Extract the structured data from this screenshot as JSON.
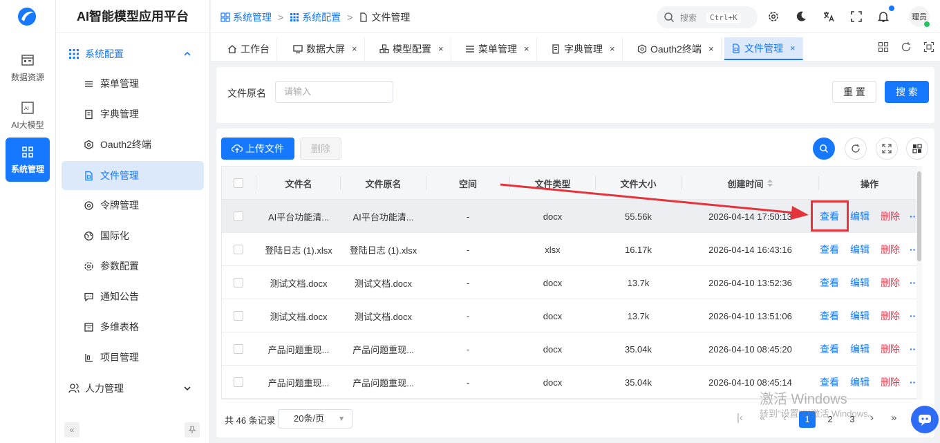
{
  "app": {
    "title": "AI智能模型应用平台"
  },
  "rail": {
    "items": [
      {
        "label": "数据资源"
      },
      {
        "label": "AI大模型"
      },
      {
        "label": "系统管理"
      }
    ]
  },
  "sidebar": {
    "group_open": "系统配置",
    "items": [
      {
        "label": "菜单管理"
      },
      {
        "label": "字典管理"
      },
      {
        "label": "Oauth2终端"
      },
      {
        "label": "文件管理"
      },
      {
        "label": "令牌管理"
      },
      {
        "label": "国际化"
      },
      {
        "label": "参数配置"
      },
      {
        "label": "通知公告"
      },
      {
        "label": "多维表格"
      },
      {
        "label": "项目管理"
      }
    ],
    "group_closed": "人力管理",
    "collapse_glyph": "«"
  },
  "breadcrumb": {
    "items": [
      "系统管理",
      "系统配置",
      "文件管理"
    ],
    "sep": ">"
  },
  "header": {
    "search_placeholder": "搜索",
    "shortcut": "Ctrl+K",
    "user": "理员"
  },
  "tabs": [
    {
      "label": "工作台"
    },
    {
      "label": "数据大屏",
      "close": "×"
    },
    {
      "label": "模型配置",
      "close": "×"
    },
    {
      "label": "菜单管理",
      "close": "×"
    },
    {
      "label": "字典管理",
      "close": "×"
    },
    {
      "label": "Oauth2终端",
      "close": "×"
    },
    {
      "label": "文件管理",
      "close": "×"
    }
  ],
  "filter": {
    "label": "文件原名",
    "placeholder": "请输入",
    "reset": "重 置",
    "search": "搜 索"
  },
  "toolbar": {
    "upload": "上传文件",
    "delete": "删除"
  },
  "table": {
    "columns": [
      "文件名",
      "文件原名",
      "空间",
      "文件类型",
      "文件大小",
      "创建时间",
      "操作"
    ],
    "rows": [
      {
        "name": "AI平台功能清...",
        "orig": "AI平台功能清...",
        "space": "-",
        "type": "docx",
        "size": "55.56k",
        "time": "2026-04-14 17:50:13"
      },
      {
        "name": "登陆日志 (1).xlsx",
        "orig": "登陆日志 (1).xlsx",
        "space": "-",
        "type": "xlsx",
        "size": "16.17k",
        "time": "2026-04-14 16:43:16"
      },
      {
        "name": "测试文档.docx",
        "orig": "测试文档.docx",
        "space": "-",
        "type": "docx",
        "size": "13.7k",
        "time": "2026-04-10 13:52:36"
      },
      {
        "name": "测试文档.docx",
        "orig": "测试文档.docx",
        "space": "-",
        "type": "docx",
        "size": "13.7k",
        "time": "2026-04-10 13:51:06"
      },
      {
        "name": "产品问题重现...",
        "orig": "产品问题重现...",
        "space": "-",
        "type": "docx",
        "size": "35.04k",
        "time": "2026-04-10 08:45:20"
      },
      {
        "name": "产品问题重现...",
        "orig": "产品问题重现...",
        "space": "-",
        "type": "docx",
        "size": "35.04k",
        "time": "2026-04-10 08:45:14"
      }
    ],
    "actions": {
      "view": "查看",
      "edit": "编辑",
      "del": "删除",
      "more": "···"
    }
  },
  "pagination": {
    "total": "共 46 条记录",
    "page_size": "20条/页",
    "pages": [
      "1",
      "2",
      "3"
    ],
    "current": "1",
    "first": "|‹",
    "prev_jump": "«",
    "prev": "‹",
    "next": "›",
    "next_jump": "»"
  },
  "watermark": {
    "line1": "激活 Windows",
    "line2": "转到\"设置\"以激活 Windows。"
  },
  "colors": {
    "primary": "#1677ff",
    "danger": "#f0394f",
    "highlight": "#e5333b"
  }
}
